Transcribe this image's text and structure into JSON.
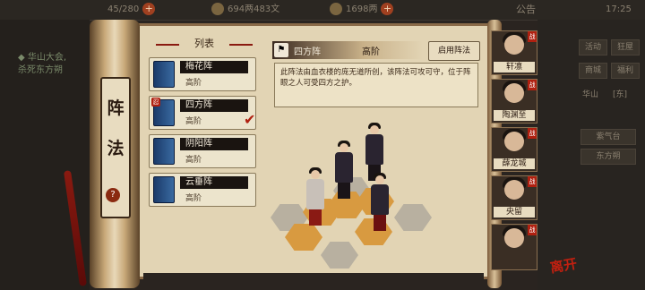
{
  "topbar": {
    "res1": "45/280",
    "res2": "694两483文",
    "res3": "1698两",
    "notice": "公告",
    "time": "17:25"
  },
  "left": {
    "quest_line1": "◆ 华山大会,",
    "quest_line2": "杀死东方朔"
  },
  "panel": {
    "vertical_title": [
      "阵",
      "法"
    ],
    "help": "?",
    "list_header": "列表"
  },
  "formations": [
    {
      "name": "梅花阵",
      "level": "高阶",
      "badge": ""
    },
    {
      "name": "四方阵",
      "level": "高阶",
      "badge": "忍"
    },
    {
      "name": "阴阳阵",
      "level": "高阶",
      "badge": ""
    },
    {
      "name": "云垂阵",
      "level": "高阶",
      "badge": ""
    }
  ],
  "detail": {
    "name": "四方阵",
    "level": "高阶",
    "use_button": "启用阵法",
    "description": "此阵法由血衣楼的庞无道所创，该阵法可攻可守，位于阵眼之人可受四方之护。"
  },
  "roster": [
    {
      "name": "轩凛",
      "flag": "战"
    },
    {
      "name": "陶渊至",
      "flag": "战"
    },
    {
      "name": "薛龙城",
      "flag": "战"
    },
    {
      "name": "央留",
      "flag": "战"
    },
    {
      "name": "",
      "flag": "战"
    }
  ],
  "right": {
    "btn1": "活动",
    "btn2": "狂屋",
    "btn3": "商城",
    "btn4": "福利",
    "loc1": "华山",
    "loc2": "[东]",
    "side1": "紫气台",
    "side2": "东方朔"
  },
  "leave": "离开",
  "colors": {
    "accent": "#b02010",
    "paper": "#e2d4b4"
  }
}
